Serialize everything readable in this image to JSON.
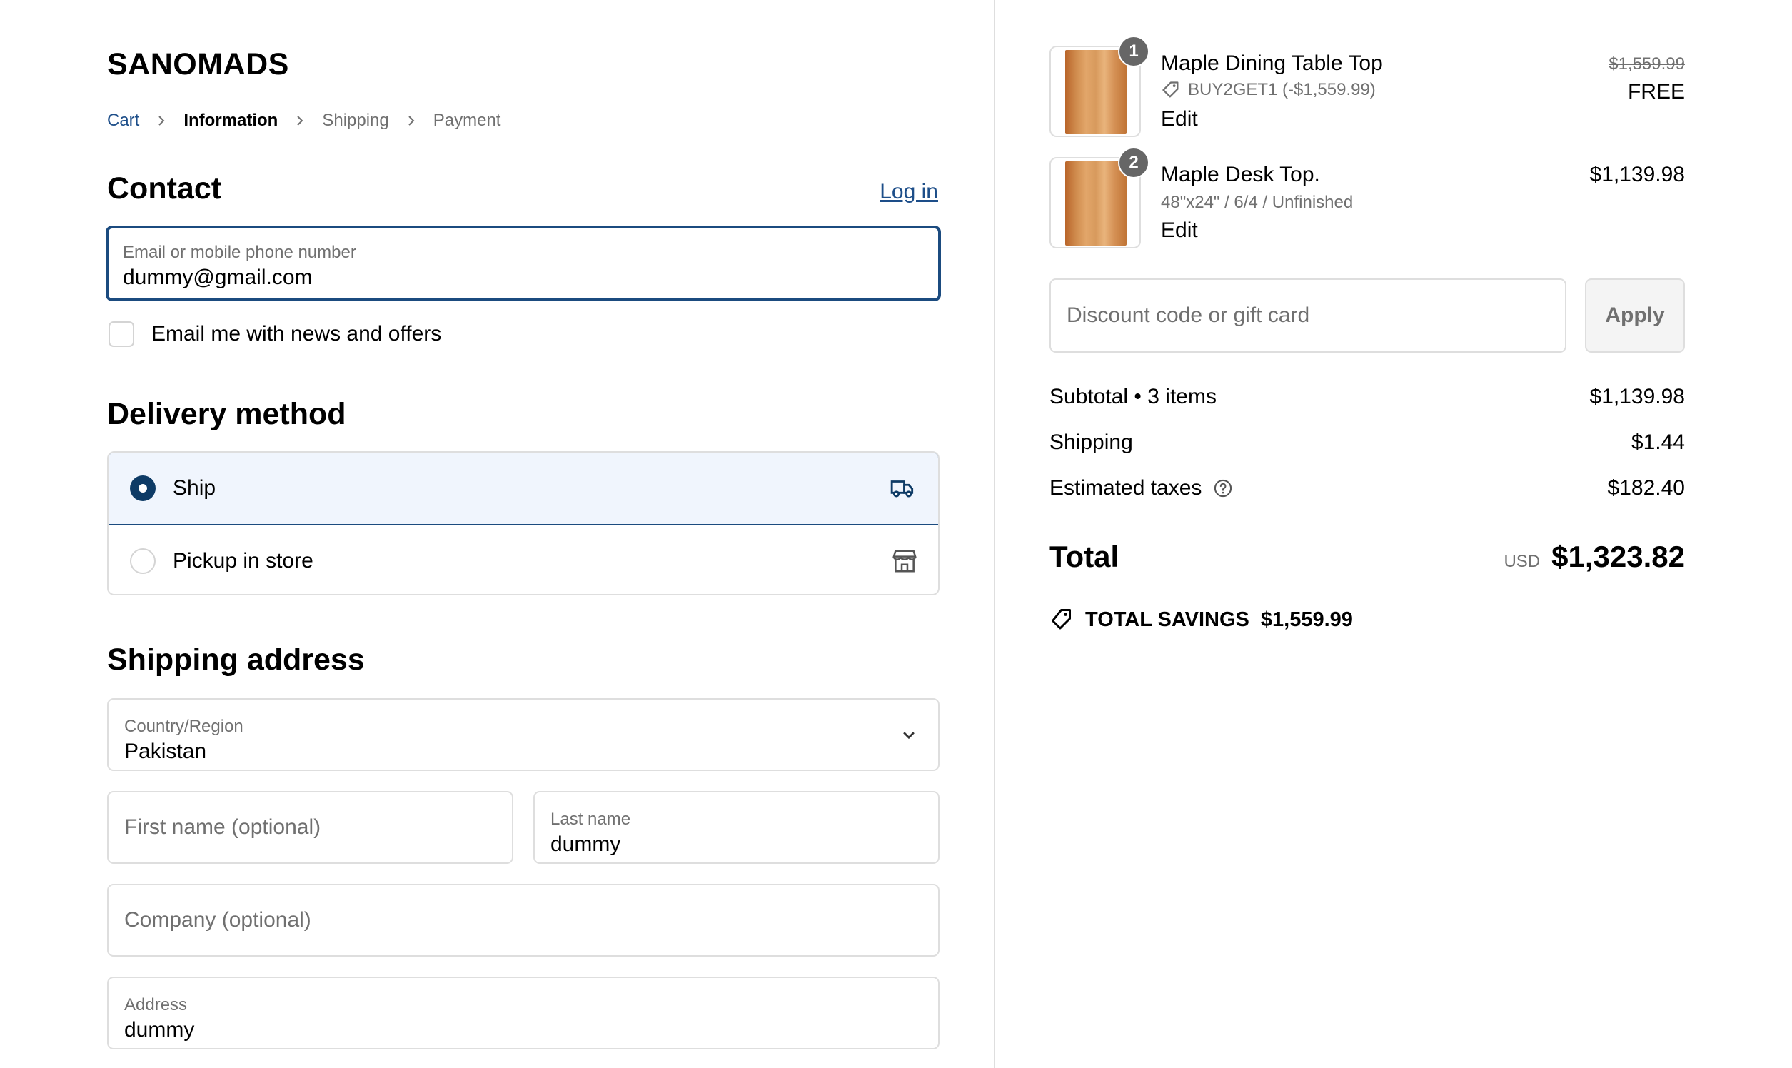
{
  "store": {
    "name": "SANOMADS"
  },
  "breadcrumb": [
    {
      "label": "Cart",
      "state": "link"
    },
    {
      "label": "Information",
      "state": "active"
    },
    {
      "label": "Shipping",
      "state": "inactive"
    },
    {
      "label": "Payment",
      "state": "inactive"
    }
  ],
  "contact": {
    "title": "Contact",
    "login_label": "Log in",
    "email_label": "Email or mobile phone number",
    "email_value": "dummy@gmail.com",
    "newsletter_label": "Email me with news and offers",
    "newsletter_checked": false
  },
  "delivery": {
    "title": "Delivery method",
    "options": [
      {
        "label": "Ship",
        "selected": true,
        "icon": "truck-icon"
      },
      {
        "label": "Pickup in store",
        "selected": false,
        "icon": "store-icon"
      }
    ]
  },
  "shipping_address": {
    "title": "Shipping address",
    "country_label": "Country/Region",
    "country_value": "Pakistan",
    "first_name_placeholder": "First name (optional)",
    "last_name_label": "Last name",
    "last_name_value": "dummy",
    "company_placeholder": "Company (optional)",
    "address_label": "Address",
    "address_value": "dummy"
  },
  "order": {
    "items": [
      {
        "quantity": "1",
        "name": "Maple Dining Table Top",
        "discount": "BUY2GET1 (-$1,559.99)",
        "edit_label": "Edit",
        "original_price": "$1,559.99",
        "price": "FREE"
      },
      {
        "quantity": "2",
        "name": "Maple Desk Top.",
        "variant": "48\"x24\" / 6/4 / Unfinished",
        "edit_label": "Edit",
        "price": "$1,139.98"
      }
    ],
    "discount_placeholder": "Discount code or gift card",
    "apply_label": "Apply",
    "subtotal_label": "Subtotal • 3 items",
    "subtotal_value": "$1,139.98",
    "shipping_label": "Shipping",
    "shipping_value": "$1.44",
    "taxes_label": "Estimated taxes",
    "taxes_value": "$182.40",
    "total_label": "Total",
    "currency": "USD",
    "total_value": "$1,323.82",
    "savings_label": "TOTAL SAVINGS",
    "savings_value": "$1,559.99"
  },
  "colors": {
    "accent": "#1b4b7f",
    "link": "#1d4e89",
    "selected_bg": "#f0f5fd",
    "muted_text": "#707070",
    "border": "#dedede"
  }
}
